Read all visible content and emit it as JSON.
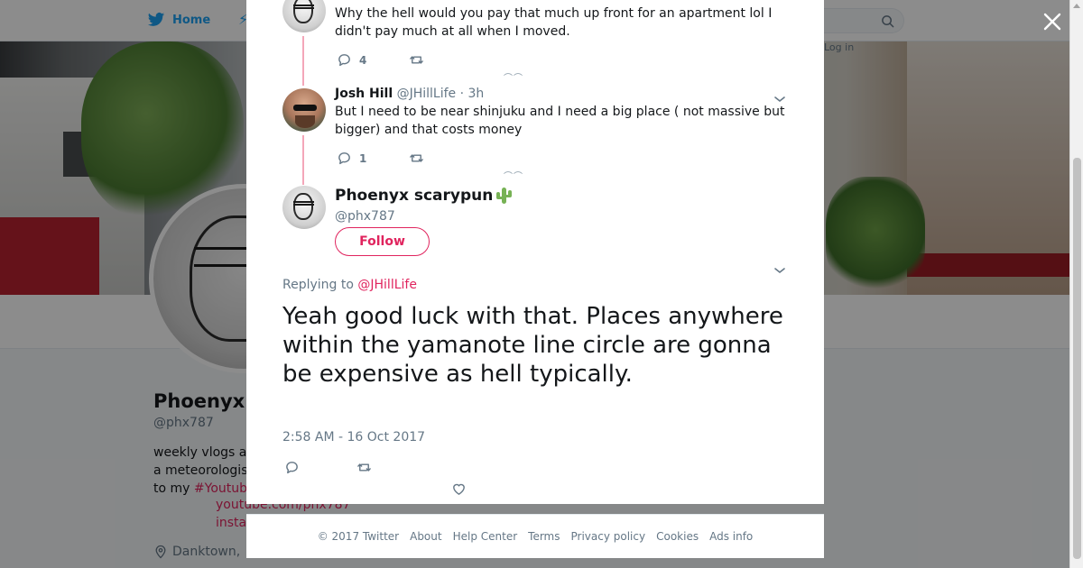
{
  "nav": {
    "home_label": "Home",
    "login_label": "Log in"
  },
  "profile": {
    "name": "Phoenyx",
    "handle": "@phx787",
    "bio_line1": "weekly vlogs a",
    "bio_line2": "a meteorologis",
    "bio_line3_prefix": "to my",
    "bio_hashtag": "#Youtub",
    "link1": "youtube.com/phx787",
    "link2": "insta",
    "location": "Danktown,"
  },
  "thread": [
    {
      "text": "Why the hell would you pay that much up front for an apartment lol I didn't pay much at all when I moved.",
      "reply_count": "4"
    },
    {
      "name": "Josh Hill",
      "handle": "@JHillLife",
      "time": "3h",
      "text": "But I need to be near shinjuku and I need a big place ( not massive but bigger) and that costs money",
      "reply_count": "1"
    }
  ],
  "main_tweet": {
    "name": "Phoenyx scarypun",
    "handle": "@phx787",
    "follow_label": "Follow",
    "replying_prefix": "Replying to",
    "replying_to": "@JHillLife",
    "text": "Yeah good luck with that. Places anywhere within the yamanote line circle are gonna be expensive as hell typically.",
    "timestamp": "2:58 AM - 16 Oct 2017"
  },
  "footer": {
    "copyright": "© 2017 Twitter",
    "links": [
      "About",
      "Help Center",
      "Terms",
      "Privacy policy",
      "Cookies",
      "Ads info"
    ]
  },
  "icons": {
    "twitter_bird": "twitter-bird-icon",
    "search": "search-icon",
    "close": "close-icon",
    "reply": "reply-icon",
    "retweet": "retweet-icon",
    "like": "heart-icon",
    "caret": "chevron-down-icon",
    "location": "location-pin-icon",
    "emoji": "cactus-emoji-icon"
  },
  "colors": {
    "accent": "#e0245e",
    "twitter_blue": "#1da1f2",
    "secondary_text": "#657786",
    "thread_line": "#f4a7b9"
  }
}
